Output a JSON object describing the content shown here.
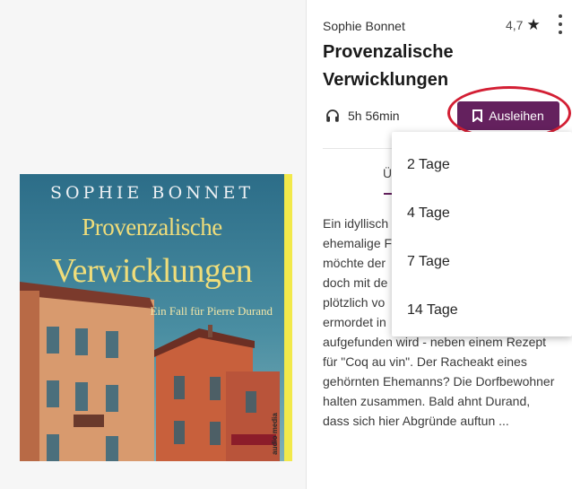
{
  "book": {
    "author": "Sophie Bonnet",
    "title_line1": "Provenzalische",
    "title_line2": "Verwicklungen",
    "rating": "4,7",
    "duration": "5h 56min"
  },
  "cover": {
    "author": "SOPHIE BONNET",
    "title_line1": "Provenzalische",
    "title_line2": "Verwicklungen",
    "subtitle": "Ein Fall für Pierre Durand",
    "imprint": "audio media"
  },
  "actions": {
    "borrow_label": "Ausleihen"
  },
  "tabs": {
    "visible_partial": "Ü"
  },
  "description_lines": [
    "Ein idyllisch",
    "ehemalige F",
    "möchte der",
    "doch mit de",
    "plötzlich vo",
    "ermordet in",
    "aufgefunden wird - neben einem Rezept",
    "für \"Coq au vin\". Der Racheakt eines",
    "gehörnten Ehemanns? Die Dorfbewohner",
    "halten zusammen. Bald ahnt Durand,",
    "dass sich hier Abgründe auftun ..."
  ],
  "borrow_options": [
    "2 Tage",
    "4 Tage",
    "7 Tage",
    "14 Tage"
  ],
  "colors": {
    "accent": "#64215e",
    "highlight": "#d31f34"
  }
}
